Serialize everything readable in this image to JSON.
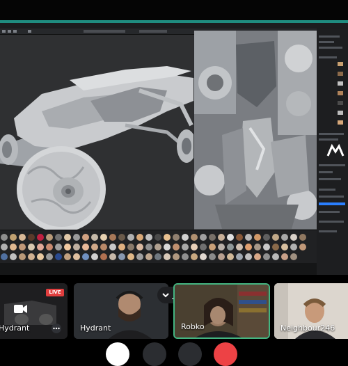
{
  "colors": {
    "accent_teal": "#1f8c80",
    "live_red": "#e13e3e",
    "speaking_green": "#43b581",
    "hangup_red": "#ed4245"
  },
  "call": {
    "tiles": [
      {
        "name": "Hydrant",
        "has_live_badge": true,
        "live_label": "LIVE"
      },
      {
        "name": "Hydrant"
      },
      {
        "name": "Robko",
        "speaking": true
      },
      {
        "name": "Neighbour246"
      }
    ],
    "icons": [
      "camera-icon",
      "more-icon",
      "chevron-down-icon",
      "people-icon"
    ]
  }
}
